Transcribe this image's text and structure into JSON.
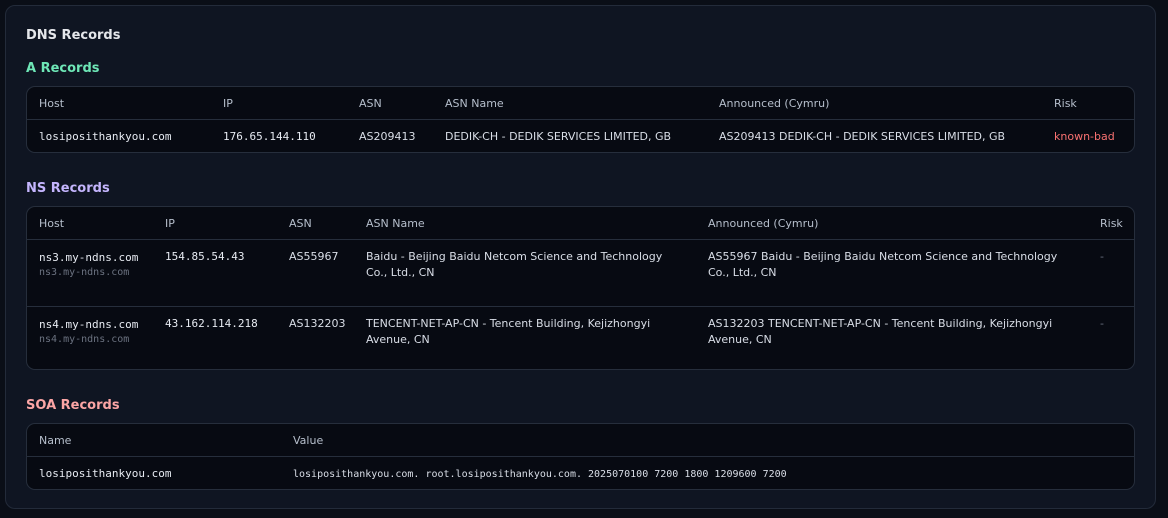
{
  "panel": {
    "title": "DNS Records"
  },
  "a_records": {
    "title": "A Records",
    "headers": [
      "Host",
      "IP",
      "ASN",
      "ASN Name",
      "Announced (Cymru)",
      "Risk"
    ],
    "rows": [
      {
        "host": "losiposithankyou.com",
        "ip": "176.65.144.110",
        "asn": "AS209413",
        "asn_name": "DEDIK-CH - DEDIK SERVICES LIMITED, GB",
        "announced": "AS209413 DEDIK-CH - DEDIK SERVICES LIMITED, GB",
        "risk": "known-bad"
      }
    ]
  },
  "ns_records": {
    "title": "NS Records",
    "headers": [
      "Host",
      "IP",
      "ASN",
      "ASN Name",
      "Announced (Cymru)",
      "Risk"
    ],
    "rows": [
      {
        "host": "ns3.my-ndns.com",
        "host_sub": "ns3.my-ndns.com",
        "ip": "154.85.54.43",
        "asn": "AS55967",
        "asn_name": "Baidu - Beijing Baidu Netcom Science and Technology Co., Ltd., CN",
        "announced": "AS55967 Baidu - Beijing Baidu Netcom Science and Technology Co., Ltd., CN",
        "risk": "-"
      },
      {
        "host": "ns4.my-ndns.com",
        "host_sub": "ns4.my-ndns.com",
        "ip": "43.162.114.218",
        "asn": "AS132203",
        "asn_name": "TENCENT-NET-AP-CN - Tencent Building, Kejizhongyi Avenue, CN",
        "announced": "AS132203 TENCENT-NET-AP-CN - Tencent Building, Kejizhongyi Avenue, CN",
        "risk": "-"
      }
    ]
  },
  "soa_records": {
    "title": "SOA Records",
    "headers": [
      "Name",
      "Value"
    ],
    "rows": [
      {
        "name": "losiposithankyou.com",
        "value": "losiposithankyou.com. root.losiposithankyou.com. 2025070100 7200 1800 1209600 7200"
      }
    ]
  },
  "colors": {
    "a_title": "#6ee7b7",
    "ns_title": "#c4b5fd",
    "soa_title": "#fca5a5",
    "risk_bad": "#f87171"
  }
}
